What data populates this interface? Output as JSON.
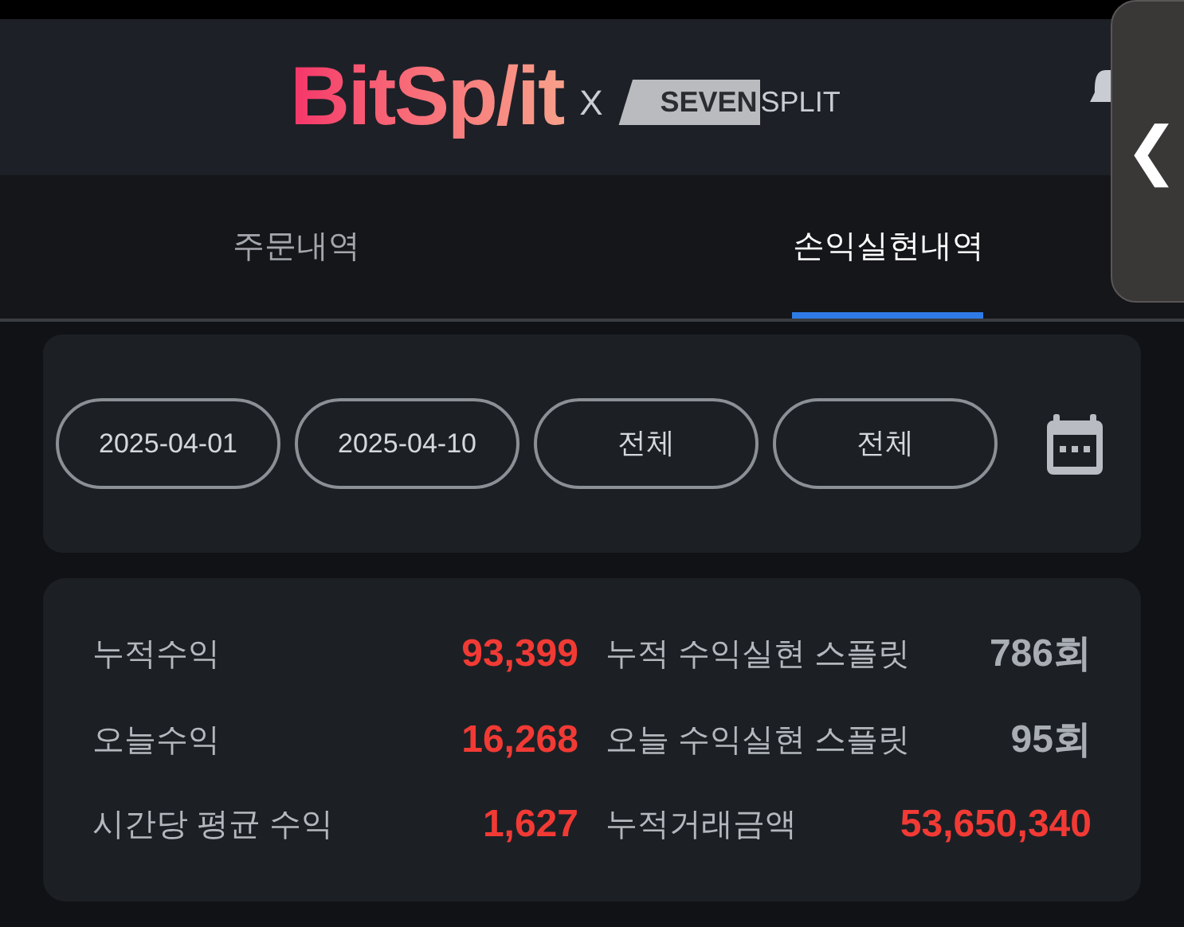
{
  "header": {
    "logo": "BitSp/it",
    "separator": "X",
    "partner_logo": [
      "SEVEN",
      "SPLIT"
    ]
  },
  "side_handle": {
    "glyph": "❮"
  },
  "tabs": [
    {
      "label": "주문내역",
      "selected": false
    },
    {
      "label": "손익실현내역",
      "selected": true
    }
  ],
  "filters": [
    {
      "kind": "date",
      "value": "2025-04-01"
    },
    {
      "kind": "date",
      "value": "2025-04-10"
    },
    {
      "kind": "select",
      "value": "전체"
    },
    {
      "kind": "select",
      "value": "전체"
    }
  ],
  "stats": [
    [
      {
        "label": "누적수익",
        "value": "93,399",
        "kind": "amount"
      },
      {
        "label": "누적 수익실현 스플릿",
        "value": "786회",
        "kind": "count"
      }
    ],
    [
      {
        "label": "오늘수익",
        "value": "16,268",
        "kind": "amount"
      },
      {
        "label": "오늘 수익실현 스플릿",
        "value": "95회",
        "kind": "count"
      }
    ],
    [
      {
        "label": "시간당 평균 수익",
        "value": "1,627",
        "kind": "amount"
      },
      {
        "label": "누적거래금액",
        "value": "53,650,340",
        "kind": "amount"
      }
    ]
  ]
}
